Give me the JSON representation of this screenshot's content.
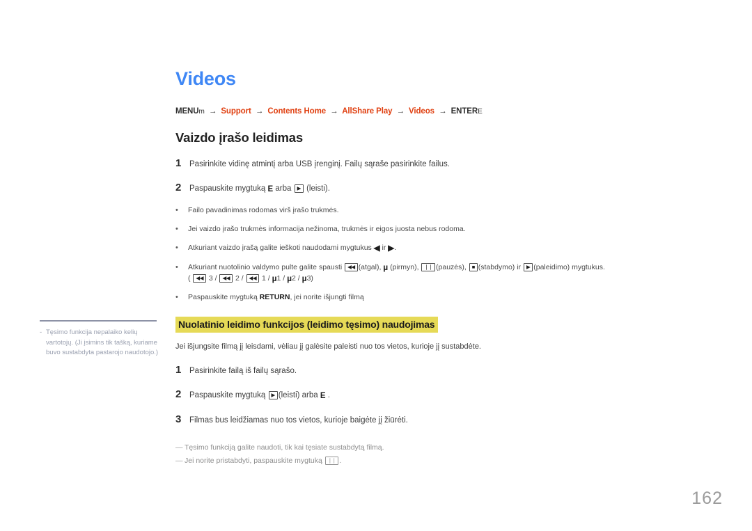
{
  "page": {
    "title": "Videos",
    "number": "162",
    "title_color": "#3f87f5",
    "link_color": "#e04011",
    "highlight_color": "#e6da57"
  },
  "breadcrumb": {
    "root_label": "MENU",
    "root_glyph": "m",
    "items": [
      {
        "label": "Support",
        "type": "link"
      },
      {
        "label": "Contents Home",
        "type": "link"
      },
      {
        "label": "AllShare Play",
        "type": "link"
      },
      {
        "label": "Videos",
        "type": "link"
      },
      {
        "label": "ENTER",
        "type": "plain"
      }
    ],
    "end_glyph": "E",
    "arrow": "→"
  },
  "section": {
    "heading": "Vaizdo įrašo leidimas",
    "steps": [
      {
        "num": "1",
        "text": "Pasirinkite vidinę atmintį arba USB įrenginį. Failų sąraše pasirinkite failus."
      },
      {
        "num": "2",
        "prefix": "Paspauskite mygtuką ",
        "key_char": "E",
        "middle": " arba ",
        "key_box": "▶",
        "suffix": " (leisti)."
      }
    ],
    "bullets": [
      {
        "text": "Failo pavadinimas rodomas virš įrašo trukmės."
      },
      {
        "text": "Jei vaizdo įrašo trukmės informacija nežinoma, trukmės ir eigos juosta nebus rodoma."
      },
      {
        "pre": "Atkuriant vaizdo įrašą galite ieškoti naudodami mygtukus ",
        "sym1": "◀",
        "mid": " ir ",
        "sym2": "▶",
        "post": "."
      },
      {
        "pre": "Atkuriant nuotolinio valdymo pulte galite spausti ",
        "k1": "◀◀",
        "t1": "(atgal), ",
        "mu1": "µ",
        "t2": " (pirmyn), ",
        "k2": "❘❘",
        "t3": "(pauzės), ",
        "k3": "■",
        "t4": "(stabdymo) ir ",
        "k4": "▶",
        "t5": "(paleidimo) mygtukus.",
        "line2": {
          "open": "( ",
          "k1": "◀◀",
          "n1": " 3 / ",
          "k2": "◀◀",
          "n2": " 2 / ",
          "k3": "◀◀",
          "n3": " 1 / ",
          "mu1": "µ",
          "n4": "1 / ",
          "mu2": "µ",
          "n5": "2 / ",
          "mu3": "µ",
          "n6": "3)"
        }
      },
      {
        "pre": "Paspauskite mygtuką ",
        "bold": "RETURN",
        "post": ", jei norite išjungti filmą"
      }
    ]
  },
  "resume": {
    "heading": "Nuolatinio leidimo funkcijos (leidimo tęsimo) naudojimas",
    "lead": "Jei išjungsite filmą jį leisdami, vėliau jį galėsite paleisti nuo tos vietos, kurioje jį sustabdėte.",
    "steps": [
      {
        "num": "1",
        "text": "Pasirinkite failą iš failų sąrašo."
      },
      {
        "num": "2",
        "prefix": "Paspauskite mygtuką ",
        "key_box": "▶",
        "middle": "(leisti) arba ",
        "key_char": "E",
        "suffix": " ."
      },
      {
        "num": "3",
        "text": "Filmas bus leidžiamas nuo tos vietos, kurioje baigėte jį žiūrėti."
      }
    ],
    "notes": [
      {
        "text": "Tęsimo funkciją galite naudoti, tik kai tęsiate sustabdytą filmą."
      },
      {
        "pre": "Jei norite pristabdyti, paspauskite mygtuką ",
        "key_box": "❘❘",
        "post": "."
      }
    ]
  },
  "side_note": {
    "bullet": "-",
    "text": "Tęsimo funkcija nepalaiko kelių vartotojų. (Ji įsimins tik tašką, kuriame buvo sustabdyta pastarojo naudotojo.)"
  }
}
